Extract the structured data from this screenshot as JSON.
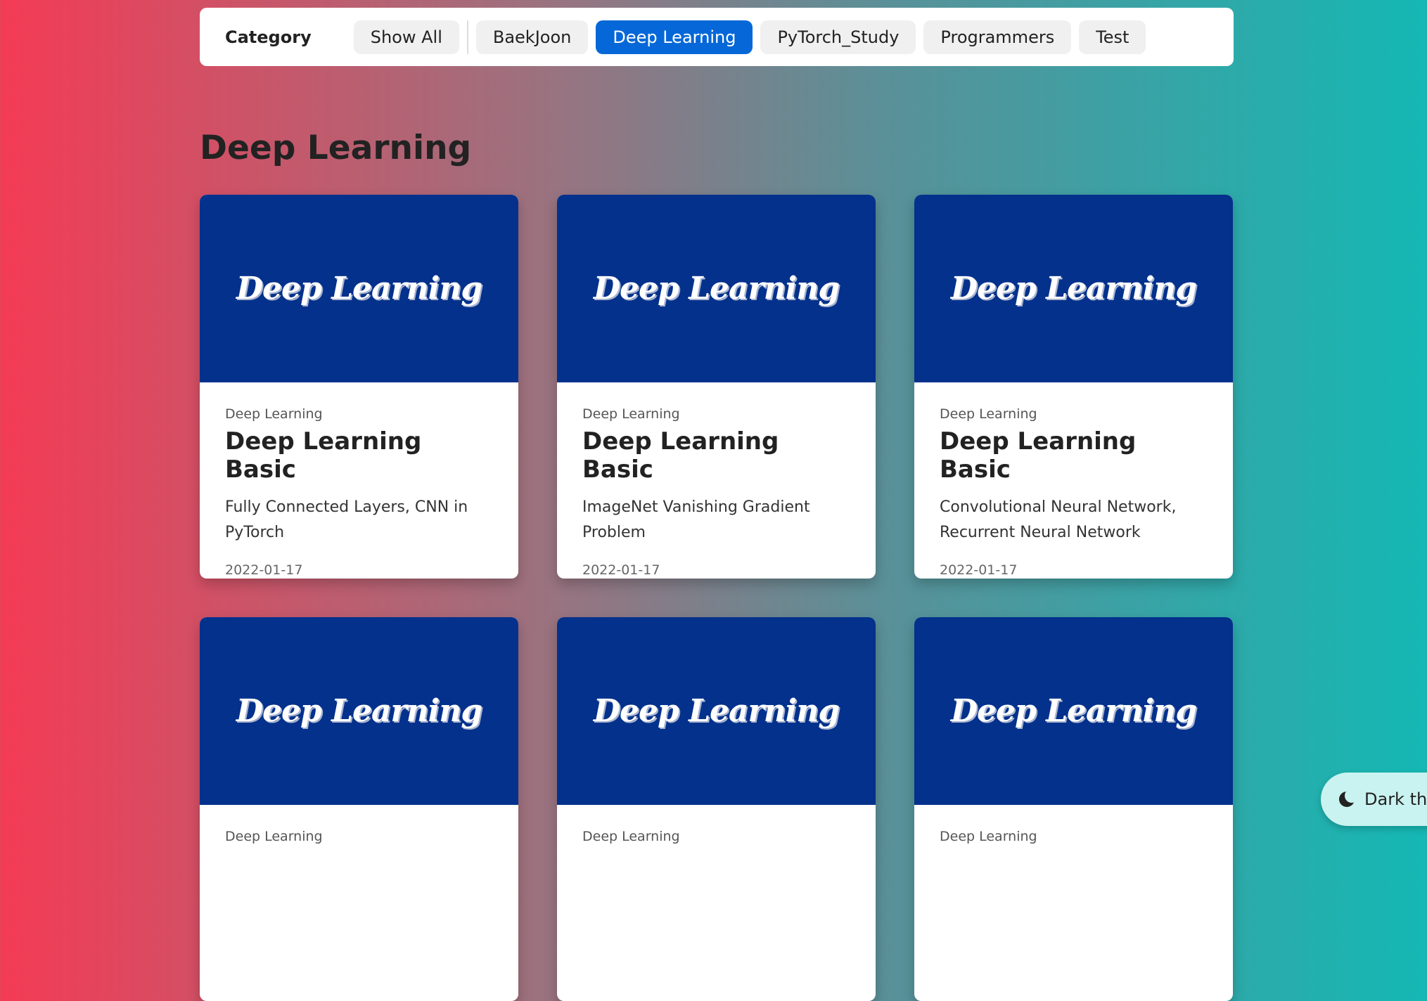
{
  "category_bar": {
    "label": "Category",
    "show_all": "Show All",
    "categories": [
      "BaekJoon",
      "Deep Learning",
      "PyTorch_Study",
      "Programmers",
      "Test"
    ],
    "active": "Deep Learning"
  },
  "section": {
    "title": "Deep Learning"
  },
  "thumbnail_text": "Deep Learning",
  "posts": [
    {
      "category": "Deep Learning",
      "title": "Deep Learning Basic",
      "desc": "Fully Connected Layers, CNN in PyTorch",
      "date": "2022-01-17"
    },
    {
      "category": "Deep Learning",
      "title": "Deep Learning Basic",
      "desc": "ImageNet Vanishing Gradient Problem",
      "date": "2022-01-17"
    },
    {
      "category": "Deep Learning",
      "title": "Deep Learning Basic",
      "desc": "Convolutional Neural Network, Recurrent Neural Network",
      "date": "2022-01-17"
    },
    {
      "category": "Deep Learning",
      "title": "",
      "desc": "",
      "date": ""
    },
    {
      "category": "Deep Learning",
      "title": "",
      "desc": "",
      "date": ""
    },
    {
      "category": "Deep Learning",
      "title": "",
      "desc": "",
      "date": ""
    }
  ],
  "theme_toggle": {
    "label": "Dark the",
    "icon": "moon-icon"
  },
  "colors": {
    "active_chip": "#0668d8",
    "thumbnail_bg": "#03318c"
  }
}
